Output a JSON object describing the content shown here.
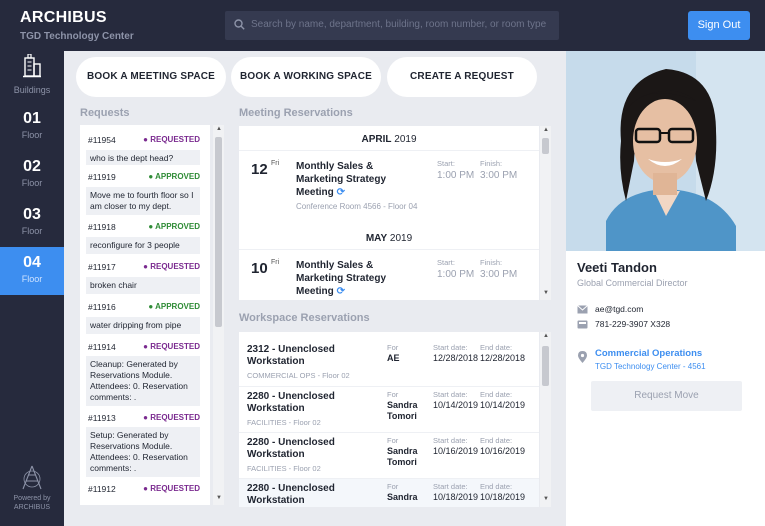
{
  "header": {
    "brand": "ARCHIBUS",
    "subtitle": "TGD Technology Center",
    "search_placeholder": "Search by name, department, building, room number, or room type",
    "signout_label": "Sign Out"
  },
  "sidebar": {
    "buildings_label": "Buildings",
    "floors": [
      {
        "num": "01",
        "label": "Floor"
      },
      {
        "num": "02",
        "label": "Floor"
      },
      {
        "num": "03",
        "label": "Floor"
      },
      {
        "num": "04",
        "label": "Floor"
      }
    ],
    "active_floor": "04",
    "powered_by": "Powered by",
    "powered_name": "ARCHIBUS"
  },
  "actions": {
    "book_meeting": "BOOK A MEETING SPACE",
    "book_working": "BOOK A WORKING SPACE",
    "create_request": "CREATE A REQUEST"
  },
  "requests": {
    "title": "Requests",
    "items": [
      {
        "id": "#11954",
        "status": "REQUESTED",
        "desc": "who is the dept head?"
      },
      {
        "id": "#11919",
        "status": "APPROVED",
        "desc": "Move me to fourth floor so I am closer to my dept."
      },
      {
        "id": "#11918",
        "status": "APPROVED",
        "desc": "reconfigure for 3 people"
      },
      {
        "id": "#11917",
        "status": "REQUESTED",
        "desc": "broken chair"
      },
      {
        "id": "#11916",
        "status": "APPROVED",
        "desc": "water dripping from pipe"
      },
      {
        "id": "#11914",
        "status": "REQUESTED",
        "desc": "Cleanup: Generated by Reservations Module. Attendees: 0. Reservation comments: ."
      },
      {
        "id": "#11913",
        "status": "REQUESTED",
        "desc": "Setup: Generated by Reservations Module. Attendees: 0. Reservation comments: ."
      },
      {
        "id": "#11912",
        "status": "REQUESTED",
        "desc": ""
      }
    ]
  },
  "meetings": {
    "title": "Meeting Reservations",
    "start_label": "Start:",
    "finish_label": "Finish:",
    "groups": [
      {
        "month": "APRIL",
        "year": "2019",
        "day": "12",
        "dow": "Fri",
        "title": "Monthly Sales & Marketing Strategy Meeting",
        "room": "Conference Room 4566 - Floor 04",
        "start": "1:00 PM",
        "finish": "3:00 PM"
      },
      {
        "month": "MAY",
        "year": "2019",
        "day": "10",
        "dow": "Fri",
        "title": "Monthly Sales & Marketing Strategy Meeting",
        "room": "",
        "start": "1:00 PM",
        "finish": "3:00 PM"
      }
    ]
  },
  "workspace": {
    "title": "Workspace Reservations",
    "for_label": "For",
    "start_label": "Start date:",
    "end_label": "End date:",
    "rows": [
      {
        "name": "2312 - Unenclosed Workstation",
        "sub": "COMMERCIAL OPS - Floor 02",
        "for": "AE",
        "start": "12/28/2018",
        "end": "12/28/2018"
      },
      {
        "name": "2280 - Unenclosed Workstation",
        "sub": "FACILITIES - Floor 02",
        "for": "Sandra Tomori",
        "start": "10/14/2019",
        "end": "10/14/2019"
      },
      {
        "name": "2280 - Unenclosed Workstation",
        "sub": "FACILITIES - Floor 02",
        "for": "Sandra Tomori",
        "start": "10/16/2019",
        "end": "10/16/2019"
      },
      {
        "name": "2280 - Unenclosed Workstation",
        "sub": "",
        "for": "Sandra",
        "start": "10/18/2019",
        "end": "10/18/2019"
      }
    ]
  },
  "profile": {
    "name": "Veeti Tandon",
    "title": "Global Commercial Director",
    "email": "ae@tgd.com",
    "phone": "781-229-3907 X328",
    "department": "Commercial Operations",
    "location": "TGD Technology Center - 4561",
    "request_move_label": "Request Move"
  },
  "colors": {
    "navy": "#262a3d",
    "accent": "#3d8ef0",
    "requested": "#7a2a8f",
    "approved": "#2e8b35"
  }
}
